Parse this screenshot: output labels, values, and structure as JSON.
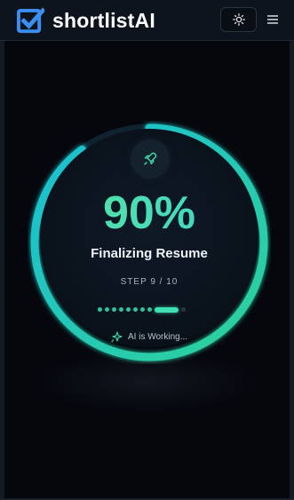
{
  "header": {
    "brand_name": "shortlistAI",
    "logo_icon": "checkbox-logo-icon",
    "theme_toggle_icon": "sun-icon",
    "menu_icon": "hamburger-menu-icon"
  },
  "progress": {
    "percent_text": "90%",
    "fraction": 0.9,
    "status": "Finalizing Resume",
    "step_text": "STEP 9 / 10",
    "current_step": 9,
    "total_steps": 10,
    "badge_icon": "rocket-icon",
    "ai_text": "AI is Working...",
    "ai_icon": "sparkle-icon"
  },
  "colors": {
    "accent_green": "#2fd29a",
    "accent_cyan": "#19bfd3",
    "background": "#05070d"
  }
}
